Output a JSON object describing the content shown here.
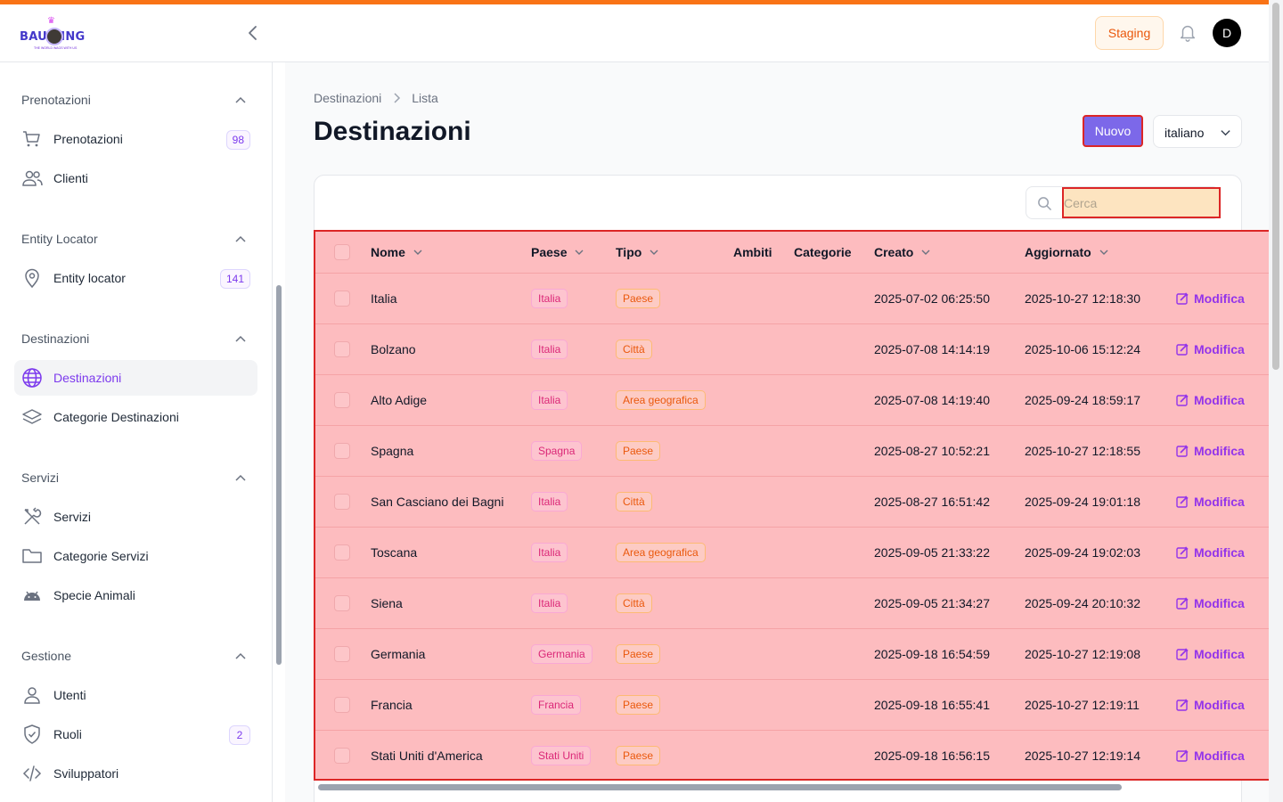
{
  "app": {
    "logo_text": "BAU  KING",
    "logo_tagline": "THE WORLD WAGS WITH US",
    "environment_badge": "Staging",
    "avatar_initial": "D",
    "accent_color": "#f97316",
    "brand_color": "#7c3aed"
  },
  "sidebar": {
    "groups": [
      {
        "title": "Prenotazioni",
        "items": [
          {
            "label": "Prenotazioni",
            "icon": "cart-icon",
            "badge": "98"
          },
          {
            "label": "Clienti",
            "icon": "users-icon",
            "badge": ""
          }
        ]
      },
      {
        "title": "Entity Locator",
        "items": [
          {
            "label": "Entity locator",
            "icon": "map-pin-icon",
            "badge": "141"
          }
        ]
      },
      {
        "title": "Destinazioni",
        "items": [
          {
            "label": "Destinazioni",
            "icon": "globe-icon",
            "badge": "",
            "active": true
          },
          {
            "label": "Categorie Destinazioni",
            "icon": "layers-icon",
            "badge": ""
          }
        ]
      },
      {
        "title": "Servizi",
        "items": [
          {
            "label": "Servizi",
            "icon": "tools-icon",
            "badge": ""
          },
          {
            "label": "Categorie Servizi",
            "icon": "folder-icon",
            "badge": ""
          },
          {
            "label": "Specie Animali",
            "icon": "android-icon",
            "badge": ""
          }
        ]
      },
      {
        "title": "Gestione",
        "items": [
          {
            "label": "Utenti",
            "icon": "user-icon",
            "badge": ""
          },
          {
            "label": "Ruoli",
            "icon": "shield-icon",
            "badge": "2"
          },
          {
            "label": "Sviluppatori",
            "icon": "code-icon",
            "badge": ""
          }
        ]
      }
    ]
  },
  "main": {
    "breadcrumb": [
      "Destinazioni",
      "Lista"
    ],
    "title": "Destinazioni",
    "new_button": "Nuovo",
    "language_select": "italiano",
    "search_placeholder": "Cerca",
    "columns": [
      "Nome",
      "Paese",
      "Tipo",
      "Ambiti",
      "Categorie",
      "Creato",
      "Aggiornato"
    ],
    "edit_label": "Modifica",
    "rows": [
      {
        "nome": "Italia",
        "paese": "Italia",
        "tipo": "Paese",
        "creato": "2025-07-02 06:25:50",
        "aggiornato": "2025-10-27 12:18:30"
      },
      {
        "nome": "Bolzano",
        "paese": "Italia",
        "tipo": "Città",
        "creato": "2025-07-08 14:14:19",
        "aggiornato": "2025-10-06 15:12:24"
      },
      {
        "nome": "Alto Adige",
        "paese": "Italia",
        "tipo": "Area geografica",
        "creato": "2025-07-08 14:19:40",
        "aggiornato": "2025-09-24 18:59:17"
      },
      {
        "nome": "Spagna",
        "paese": "Spagna",
        "tipo": "Paese",
        "creato": "2025-08-27 10:52:21",
        "aggiornato": "2025-10-27 12:18:55"
      },
      {
        "nome": "San Casciano dei Bagni",
        "paese": "Italia",
        "tipo": "Città",
        "creato": "2025-08-27 16:51:42",
        "aggiornato": "2025-09-24 19:01:18"
      },
      {
        "nome": "Toscana",
        "paese": "Italia",
        "tipo": "Area geografica",
        "creato": "2025-09-05 21:33:22",
        "aggiornato": "2025-09-24 19:02:03"
      },
      {
        "nome": "Siena",
        "paese": "Italia",
        "tipo": "Città",
        "creato": "2025-09-05 21:34:27",
        "aggiornato": "2025-09-24 20:10:32"
      },
      {
        "nome": "Germania",
        "paese": "Germania",
        "tipo": "Paese",
        "creato": "2025-09-18 16:54:59",
        "aggiornato": "2025-10-27 12:19:08"
      },
      {
        "nome": "Francia",
        "paese": "Francia",
        "tipo": "Paese",
        "creato": "2025-09-18 16:55:41",
        "aggiornato": "2025-10-27 12:19:11"
      },
      {
        "nome": "Stati Uniti d'America",
        "paese": "Stati Uniti",
        "tipo": "Paese",
        "creato": "2025-09-18 16:56:15",
        "aggiornato": "2025-10-27 12:19:14"
      }
    ]
  }
}
